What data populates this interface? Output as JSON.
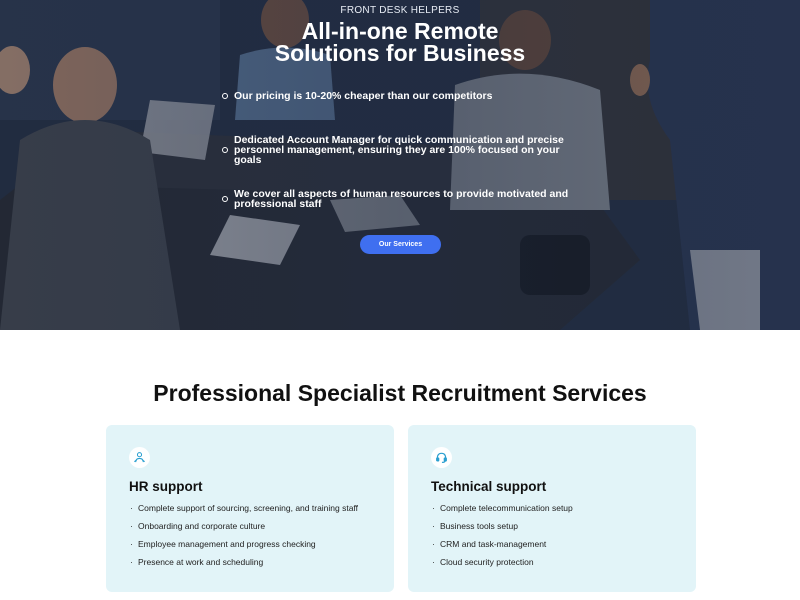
{
  "hero": {
    "eyebrow": "FRONT DESK HELPERS",
    "title_line1": "All-in-one Remote",
    "title_line2": "Solutions for Business",
    "points": [
      {
        "line1": "Our pricing is 10-20% cheaper than our competitors",
        "line2": ""
      },
      {
        "line1": "Dedicated Account Manager for quick communication and precise",
        "line2": "personnel management, ensuring they are 100% focused on your goals"
      },
      {
        "line1": "We cover all aspects of human resources to provide motivated and",
        "line2": "professional staff"
      }
    ],
    "cta_label": "Our Services"
  },
  "services": {
    "title": "Professional Specialist Recruitment Services",
    "cards": [
      {
        "icon": "hr-person-icon",
        "title": "HR support",
        "items": [
          "Complete support of sourcing, screening, and training staff",
          "Onboarding and corporate culture",
          "Employee management and progress checking",
          "Presence at work and scheduling"
        ]
      },
      {
        "icon": "headset-icon",
        "title": "Technical support",
        "items": [
          "Complete telecommunication setup",
          "Business tools setup",
          "CRM and task-management",
          "Cloud security protection"
        ]
      }
    ]
  },
  "colors": {
    "accent": "#3f6ff0",
    "card_bg": "#e2f4f8",
    "icon_color": "#2a9fd0"
  }
}
